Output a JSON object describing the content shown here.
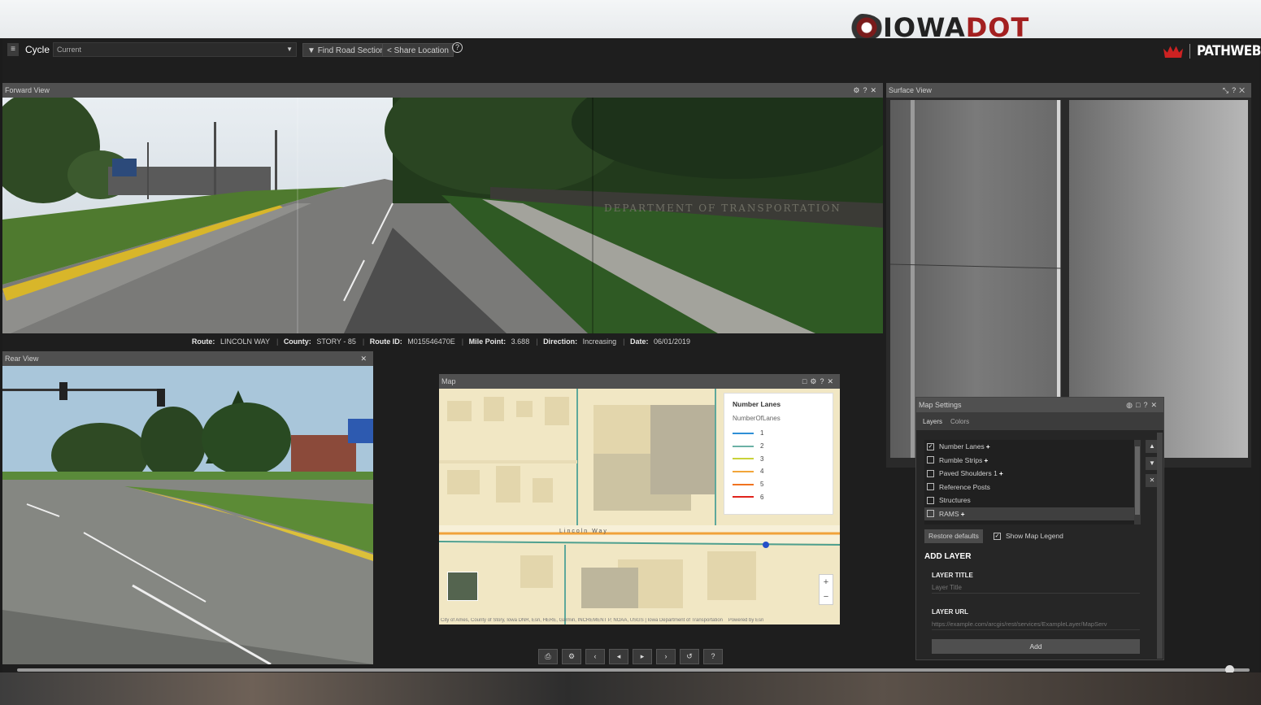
{
  "branding": {
    "agency_logo_text_main": "IOWA",
    "agency_logo_text_accent": "DOT",
    "app_logo_text": "PATHWEB",
    "accent_color": "#cc2222"
  },
  "toolbar": {
    "menu_icon": "hamburger-icon",
    "cycle_label": "Cycle",
    "cycle_value": "Current",
    "find_road_label": "Find Road Section",
    "share_label": "Share Location",
    "help_icon": "question-circle-icon"
  },
  "forward_view": {
    "title": "Forward View",
    "sign_text": "DEPARTMENT OF TRANSPORTATION"
  },
  "info_bar": {
    "route_label": "Route:",
    "route_value": "LINCOLN WAY",
    "county_label": "County:",
    "county_value": "STORY - 85",
    "route_id_label": "Route ID:",
    "route_id_value": "M015546470E",
    "mile_point_label": "Mile Point:",
    "mile_point_value": "3.688",
    "direction_label": "Direction:",
    "direction_value": "Increasing",
    "date_label": "Date:",
    "date_value": "06/01/2019"
  },
  "rear_view": {
    "title": "Rear View"
  },
  "surface_view": {
    "title": "Surface View"
  },
  "map": {
    "title": "Map",
    "street_label": "Lincoln Way",
    "legend_title": "Number Lanes",
    "legend_subtitle": "NumberOfLanes",
    "legend_items": [
      {
        "label": "1",
        "color": "#2f8fd6"
      },
      {
        "label": "2",
        "color": "#6bb1a5"
      },
      {
        "label": "3",
        "color": "#c9d23a"
      },
      {
        "label": "4",
        "color": "#f2a53a"
      },
      {
        "label": "5",
        "color": "#f07320"
      },
      {
        "label": "6",
        "color": "#e0231c"
      }
    ],
    "attribution": "City of Ames, County of Story, Iowa DNR, Esri, HERE, Garmin, INCREMENT P, NOAA, USGS | Iowa Department of Transportation",
    "powered_by": "Powered by Esri",
    "zoom_in": "+",
    "zoom_out": "−"
  },
  "map_settings": {
    "title": "Map Settings",
    "tabs": [
      "Layers",
      "Colors"
    ],
    "layers": [
      {
        "label": "Number Lanes",
        "checked": true,
        "plus": "+"
      },
      {
        "label": "Rumble Strips",
        "checked": false,
        "plus": "+"
      },
      {
        "label": "Paved Shoulders 1",
        "checked": false,
        "plus": "+"
      },
      {
        "label": "Reference Posts",
        "checked": false,
        "plus": ""
      },
      {
        "label": "Structures",
        "checked": false,
        "plus": ""
      },
      {
        "label": "RAMS",
        "checked": false,
        "plus": "+"
      }
    ],
    "restore_label": "Restore defaults",
    "show_legend_label": "Show Map Legend",
    "add_layer_heading": "ADD LAYER",
    "layer_title_label": "LAYER TITLE",
    "layer_title_placeholder": "Layer Title",
    "layer_url_label": "LAYER URL",
    "layer_url_placeholder": "https://example.com/arcgis/rest/services/ExampleLayer/MapServ",
    "add_button": "Add"
  }
}
